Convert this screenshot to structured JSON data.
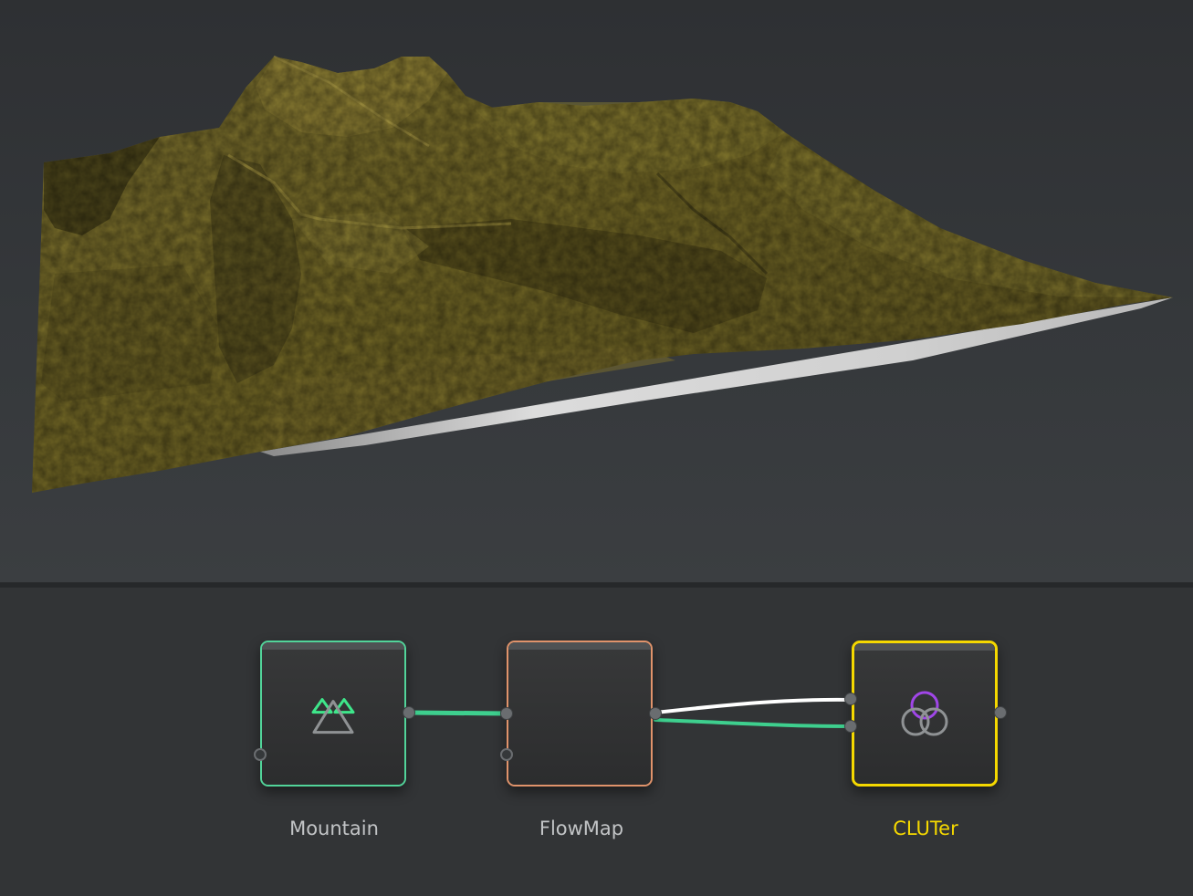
{
  "viewport": {
    "terrain_color": "#6e6328",
    "terrain_highlight": "#a8963e",
    "terrain_shadow": "#2f2b14",
    "base_color": "#d8d8d8",
    "background_color": "#34373a"
  },
  "graph": {
    "nodes": [
      {
        "id": "mountain",
        "label": "Mountain",
        "icon": "mountain-icon",
        "border_color": "#52d49a",
        "selected": false
      },
      {
        "id": "flowmap",
        "label": "FlowMap",
        "icon": "none",
        "border_color": "#e0936b",
        "selected": false
      },
      {
        "id": "cluter",
        "label": "CLUTer",
        "icon": "color-circles-icon",
        "border_color": "#f5d800",
        "selected": true
      }
    ],
    "connections": [
      {
        "from": "mountain.output",
        "to": "flowmap.input-1",
        "color": "#3ecf8e"
      },
      {
        "from": "flowmap.output",
        "to": "cluter.input-1",
        "color": "#ffffff"
      },
      {
        "from": "flowmap.output",
        "to": "cluter.input-2",
        "color": "#3ecf8e"
      }
    ]
  }
}
